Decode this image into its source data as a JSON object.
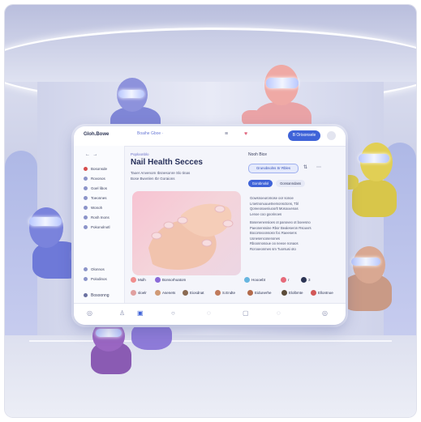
{
  "tablet": {
    "brand": "Gloh.Bowe",
    "search": "Boaihe  Gboe ·",
    "topbar_pill": "B Orisonsele",
    "sidebar": {
      "items": [
        "Bosonsde",
        "Rovonos",
        "Goel libos",
        "Toeonnes",
        "Wonoh",
        "Rosh Inons",
        "Pokonolnotl"
      ],
      "bottom_items": [
        "Olonnos",
        "Polodinos"
      ],
      "footer": "Bosoonng"
    },
    "post": {
      "author": "Poploonblo",
      "title": "Nail Health Secces",
      "text_1": "Taoer Anvenom Ibsnesonre Slo tinas",
      "text_2": "Bose Bwvnlen Ibr Goraions"
    },
    "right_panel": {
      "header": "Nooh Bice",
      "button": "Grunobsolns Sr Rbles",
      "tab_1": "Gorobnolol",
      "tab_2": "Gonsanndass",
      "lines": [
        "Gowsnoeuromose oor sonoe",
        "Lroetnonuuuetnemonsctons, Tbl",
        "Qoreeonaeniuoorlt Mosouvenas",
        "Lenoe coo goorinoes",
        "Bosenenensioes ot panoveo ot boeesno",
        "Paeonenssine Rbor Bealeseron Rsouvrs",
        "Bocorsvoonsosn foc Raeesens",
        "Uonesencosenones",
        "Rboonnosoue oo neeoe nonaos",
        "Rcrooeonmes sm Tuorsusi oto"
      ]
    },
    "chips": [
      "Mulh",
      "Bonsorhoatom",
      "Hoooebt",
      "r",
      "3"
    ],
    "chips_row2": [
      "sloelr",
      "Asenets",
      "Eiosdnat",
      "S.Endte",
      "Eidunerhe",
      "Elolbmte",
      "Ellontnoe"
    ]
  }
}
